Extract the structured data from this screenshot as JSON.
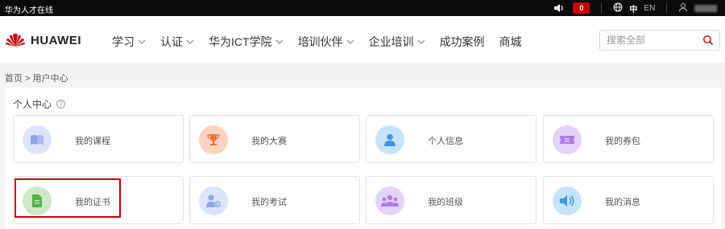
{
  "topbar": {
    "site_name": "华为人才在线",
    "notification_count": "0",
    "lang_zh": "中",
    "lang_en": "EN"
  },
  "header": {
    "brand": "HUAWEI",
    "nav": [
      {
        "label": "学习",
        "has_dropdown": true
      },
      {
        "label": "认证",
        "has_dropdown": true
      },
      {
        "label": "华为ICT学院",
        "has_dropdown": true
      },
      {
        "label": "培训伙伴",
        "has_dropdown": true
      },
      {
        "label": "企业培训",
        "has_dropdown": true
      },
      {
        "label": "成功案例",
        "has_dropdown": false
      },
      {
        "label": "商城",
        "has_dropdown": false
      }
    ],
    "search_placeholder": "搜索全部"
  },
  "breadcrumb": "首页 > 用户中心",
  "panel": {
    "title": "个人中心",
    "help_glyph": "?",
    "cards": [
      {
        "label": "我的课程",
        "icon": "book-icon",
        "color": "#dbe4fb",
        "fg": "#8ca4e8"
      },
      {
        "label": "我的大赛",
        "icon": "trophy-icon",
        "color": "#fbd3c0",
        "fg": "#e8743d"
      },
      {
        "label": "个人信息",
        "icon": "person-icon",
        "color": "#c7e3fb",
        "fg": "#3d95e8"
      },
      {
        "label": "我的券包",
        "icon": "ticket-icon",
        "color": "#e3d3f7",
        "fg": "#b27ae8"
      },
      {
        "label": "我的证书",
        "icon": "certificate-icon",
        "color": "#cfe7c6",
        "fg": "#56b24b"
      },
      {
        "label": "我的考试",
        "icon": "exam-icon",
        "color": "#dbe4fb",
        "fg": "#8ca4e8"
      },
      {
        "label": "我的班级",
        "icon": "group-icon",
        "color": "#e3d3f7",
        "fg": "#b27ae8"
      },
      {
        "label": "我的消息",
        "icon": "speaker-icon",
        "color": "#c7e3fb",
        "fg": "#3d95e8"
      }
    ]
  }
}
